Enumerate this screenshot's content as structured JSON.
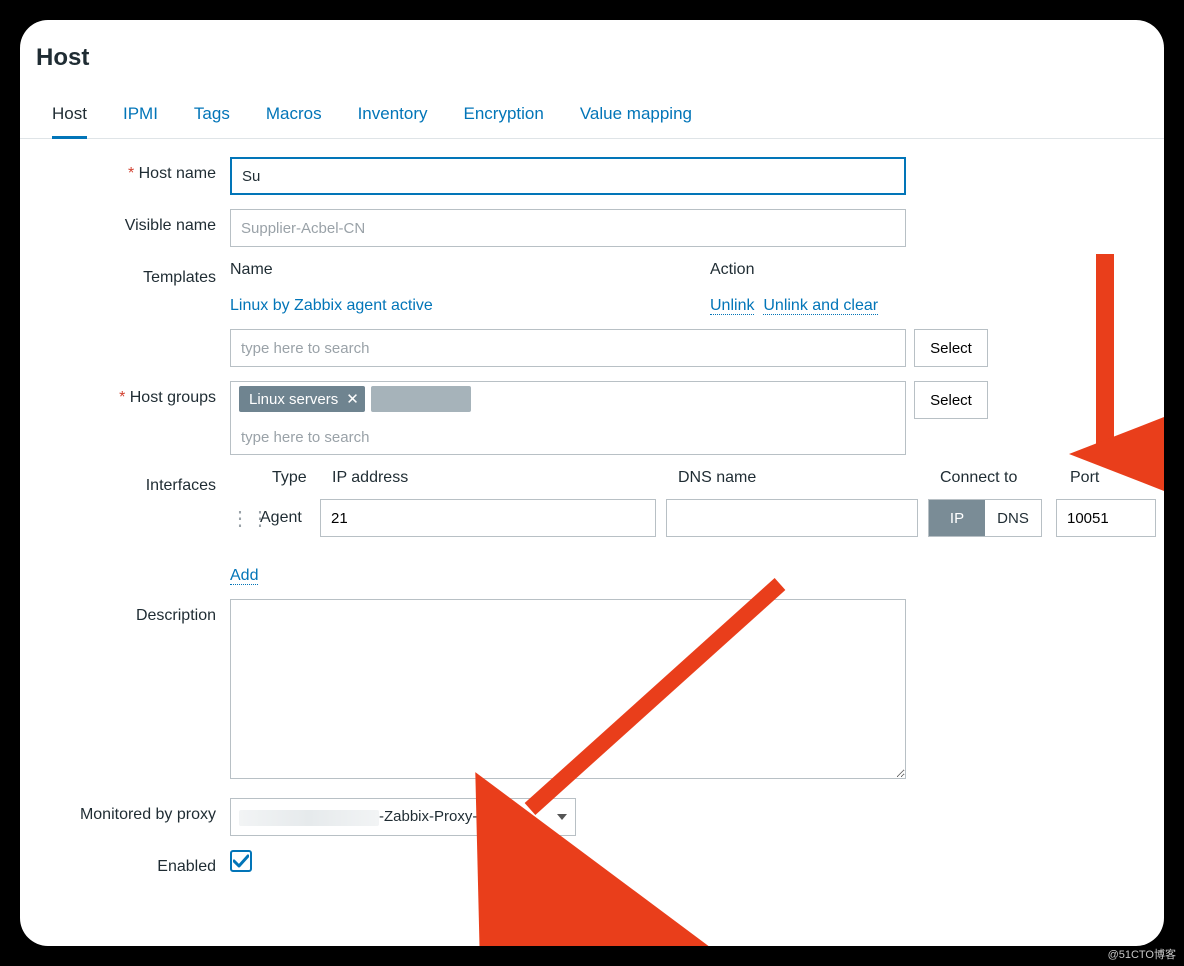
{
  "page_title": "Host",
  "tabs": [
    "Host",
    "IPMI",
    "Tags",
    "Macros",
    "Inventory",
    "Encryption",
    "Value mapping"
  ],
  "active_tab_index": 0,
  "fields": {
    "host_name": {
      "label": "Host name",
      "required": true,
      "value": "Su"
    },
    "visible_name": {
      "label": "Visible name",
      "placeholder": "Supplier-Acbel-CN"
    },
    "templates": {
      "label": "Templates",
      "col_name": "Name",
      "col_action": "Action",
      "row_name": "Linux by Zabbix agent active",
      "row_actions": [
        "Unlink",
        "Unlink and clear"
      ],
      "search_placeholder": "type here to search",
      "select_btn": "Select"
    },
    "host_groups": {
      "label": "Host groups",
      "required": true,
      "chip": "Linux servers",
      "search_placeholder": "type here to search",
      "select_btn": "Select"
    },
    "interfaces": {
      "label": "Interfaces",
      "headers": {
        "type": "Type",
        "ip": "IP address",
        "dns": "DNS name",
        "connect": "Connect to",
        "port": "Port"
      },
      "row": {
        "type": "Agent",
        "ip": "21",
        "dns": "",
        "connect_options": [
          "IP",
          "DNS"
        ],
        "active_conn": 0,
        "port": "10051"
      },
      "add": "Add"
    },
    "description": {
      "label": "Description",
      "value": ""
    },
    "proxy": {
      "label": "Monitored by proxy",
      "value_suffix": "-Zabbix-Proxy-"
    },
    "enabled": {
      "label": "Enabled",
      "checked": true
    }
  },
  "watermark": "@51CTO博客"
}
